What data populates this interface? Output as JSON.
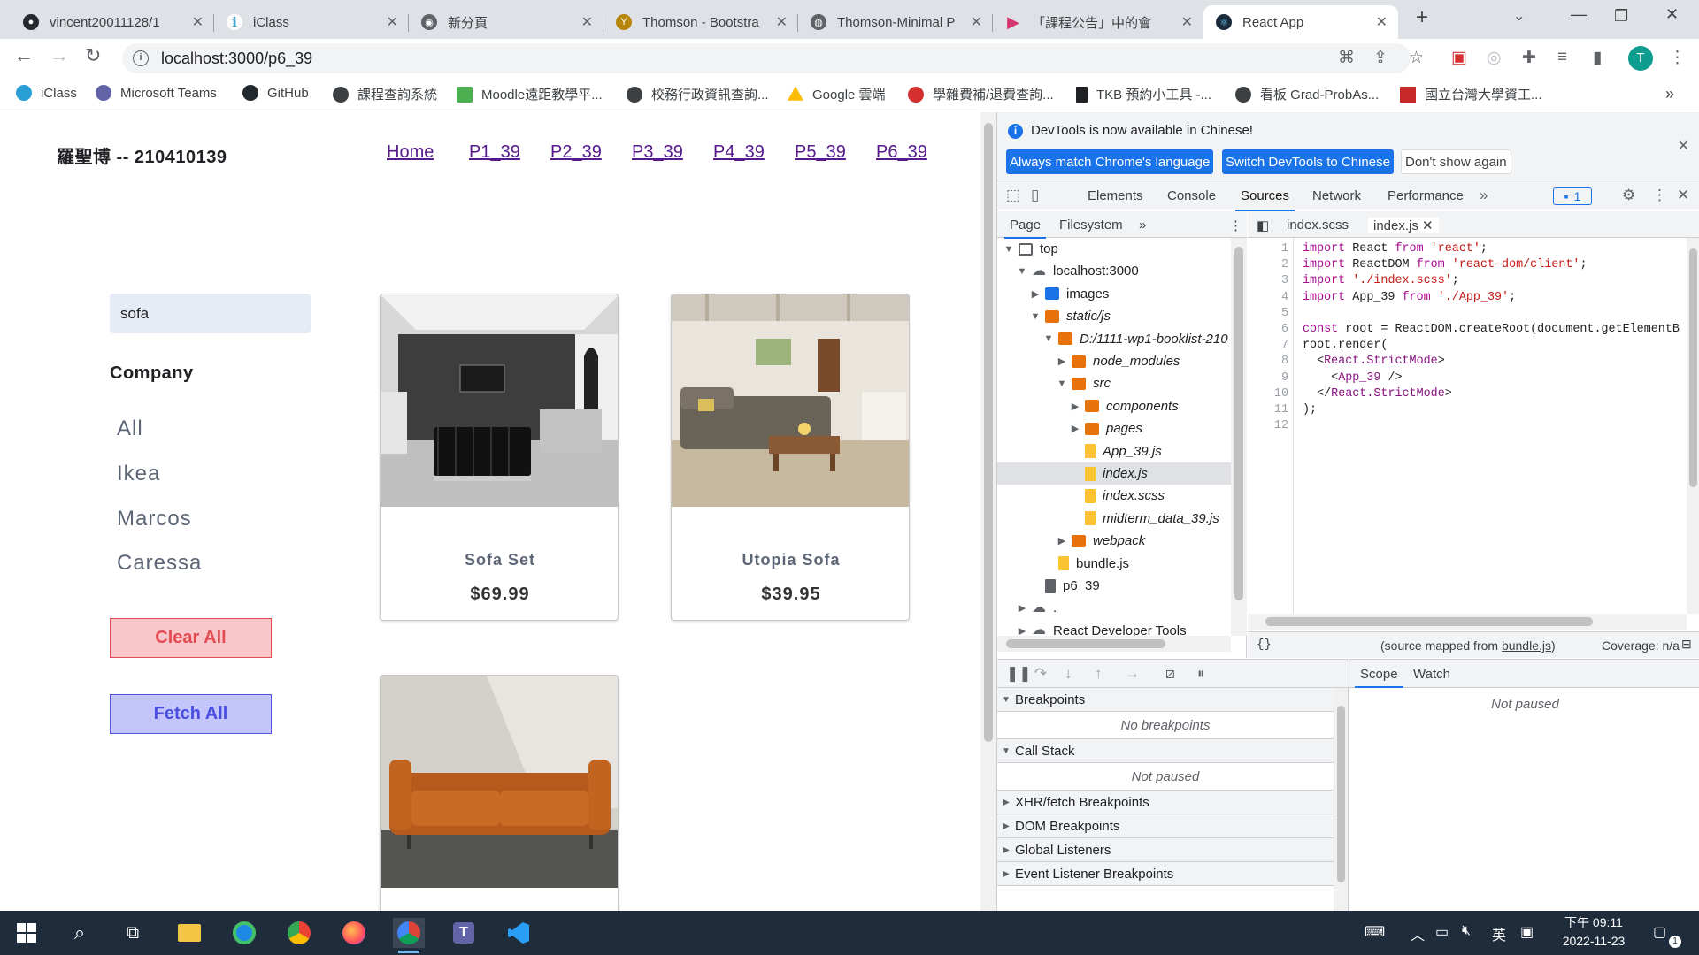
{
  "browser": {
    "tabs": [
      {
        "title": "vincent20011128/1",
        "icon": "github-icon",
        "color": "#24292e"
      },
      {
        "title": "iClass",
        "icon": "iclass-icon",
        "color": "#2a9fd6"
      },
      {
        "title": "新分頁",
        "icon": "chrome-icon",
        "color": "#5f6368"
      },
      {
        "title": "Thomson - Bootstra",
        "icon": "thomson-icon",
        "color": "#b8860b"
      },
      {
        "title": "Thomson-Minimal P",
        "icon": "globe-icon",
        "color": "#5f6368"
      },
      {
        "title": "「課程公告」中的會",
        "icon": "play-icon",
        "color": "#d6336c"
      },
      {
        "title": "React App",
        "icon": "react-icon",
        "color": "#1b2a3a"
      }
    ],
    "new_tab": "+",
    "url": "localhost:3000/p6_39",
    "profile_initial": "T",
    "bookmarks": [
      {
        "label": "iClass",
        "color": "#2a9fd6"
      },
      {
        "label": "Microsoft Teams",
        "color": "#6264a7"
      },
      {
        "label": "GitHub",
        "color": "#24292e"
      },
      {
        "label": "課程查詢系統",
        "color": "#3c4043"
      },
      {
        "label": "Moodle遠距教學平...",
        "color": "#4caf50"
      },
      {
        "label": "校務行政資訊查詢...",
        "color": "#3c4043"
      },
      {
        "label": "Google 雲端",
        "color": "#fbbc04"
      },
      {
        "label": "學雜費補/退費查詢...",
        "color": "#d32f2f"
      },
      {
        "label": "TKB 預約小工具 -...",
        "color": "#202124"
      },
      {
        "label": "看板 Grad-ProbAs...",
        "color": "#3c4043"
      },
      {
        "label": "國立台灣大學資工...",
        "color": "#c62828"
      }
    ]
  },
  "app": {
    "author": "羅聖博 -- 210410139",
    "nav": [
      "Home",
      "P1_39",
      "P2_39",
      "P3_39",
      "P4_39",
      "P5_39",
      "P6_39"
    ],
    "search_value": "sofa",
    "company_title": "Company",
    "companies": [
      "All",
      "Ikea",
      "Marcos",
      "Caressa"
    ],
    "clear_label": "Clear All",
    "fetch_label": "Fetch All",
    "products": [
      {
        "name": "Sofa Set",
        "price": "$69.99"
      },
      {
        "name": "Utopia Sofa",
        "price": "$39.95"
      },
      {
        "name": "",
        "price": ""
      }
    ]
  },
  "devtools": {
    "info_message": "DevTools is now available in Chinese!",
    "btn_match": "Always match Chrome's language",
    "btn_switch": "Switch DevTools to Chinese",
    "btn_dont_show": "Don't show again",
    "tabs": [
      "Elements",
      "Console",
      "Sources",
      "Network",
      "Performance"
    ],
    "issues_count": "1",
    "nav_tabs": [
      "Page",
      "Filesystem"
    ],
    "tree": [
      {
        "label": "top",
        "indent": 0,
        "arrow": "▼",
        "icon": "frame"
      },
      {
        "label": "localhost:3000",
        "indent": 1,
        "arrow": "▼",
        "icon": "cloud"
      },
      {
        "label": "images",
        "indent": 2,
        "arrow": "▶",
        "icon": "folder-blue"
      },
      {
        "label": "static/js",
        "indent": 2,
        "arrow": "▼",
        "icon": "folder-orange",
        "italic": true
      },
      {
        "label": "D:/1111-wp1-booklist-210",
        "indent": 3,
        "arrow": "▼",
        "icon": "folder-orange",
        "italic": true
      },
      {
        "label": "node_modules",
        "indent": 4,
        "arrow": "▶",
        "icon": "folder-orange",
        "italic": true
      },
      {
        "label": "src",
        "indent": 4,
        "arrow": "▼",
        "icon": "folder-orange",
        "italic": true
      },
      {
        "label": "components",
        "indent": 5,
        "arrow": "▶",
        "icon": "folder-orange",
        "italic": true
      },
      {
        "label": "pages",
        "indent": 5,
        "arrow": "▶",
        "icon": "folder-orange",
        "italic": true
      },
      {
        "label": "App_39.js",
        "indent": 5,
        "arrow": "",
        "icon": "file-yellow",
        "italic": true
      },
      {
        "label": "index.js",
        "indent": 5,
        "arrow": "",
        "icon": "file-yellow",
        "italic": true,
        "selected": true
      },
      {
        "label": "index.scss",
        "indent": 5,
        "arrow": "",
        "icon": "file-yellow",
        "italic": true
      },
      {
        "label": "midterm_data_39.js",
        "indent": 5,
        "arrow": "",
        "icon": "file-yellow",
        "italic": true
      },
      {
        "label": "webpack",
        "indent": 4,
        "arrow": "▶",
        "icon": "folder-orange",
        "italic": true
      },
      {
        "label": "bundle.js",
        "indent": 3,
        "arrow": "",
        "icon": "file-yellow"
      },
      {
        "label": "p6_39",
        "indent": 2,
        "arrow": "",
        "icon": "file-gray"
      },
      {
        "label": ".",
        "indent": 1,
        "arrow": "▶",
        "icon": "cloud"
      },
      {
        "label": "React Developer Tools",
        "indent": 1,
        "arrow": "▶",
        "icon": "cloud"
      }
    ],
    "editor_tabs": [
      "index.scss",
      "index.js"
    ],
    "code_lines": [
      "import React from 'react';",
      "import ReactDOM from 'react-dom/client';",
      "import './index.scss';",
      "import App_39 from './App_39';",
      "",
      "const root = ReactDOM.createRoot(document.getElementB",
      "root.render(",
      "  <React.StrictMode>",
      "    <App_39 />",
      "  </React.StrictMode>",
      ");",
      ""
    ],
    "source_mapped_prefix": "(source mapped from ",
    "source_mapped_file": "bundle.js",
    "source_mapped_suffix": ")",
    "coverage": "Coverage: n/a",
    "format_label": "{}",
    "sections": [
      {
        "title": "Breakpoints",
        "expanded": true,
        "body": "No breakpoints"
      },
      {
        "title": "Call Stack",
        "expanded": true,
        "body": "Not paused"
      },
      {
        "title": "XHR/fetch Breakpoints",
        "expanded": false
      },
      {
        "title": "DOM Breakpoints",
        "expanded": false
      },
      {
        "title": "Global Listeners",
        "expanded": false
      },
      {
        "title": "Event Listener Breakpoints",
        "expanded": false
      }
    ],
    "scope_tabs": [
      "Scope",
      "Watch"
    ],
    "scope_body": "Not paused"
  },
  "taskbar": {
    "time": "下午 09:11",
    "date": "2022-11-23",
    "ime": "英",
    "notifications": "1"
  }
}
